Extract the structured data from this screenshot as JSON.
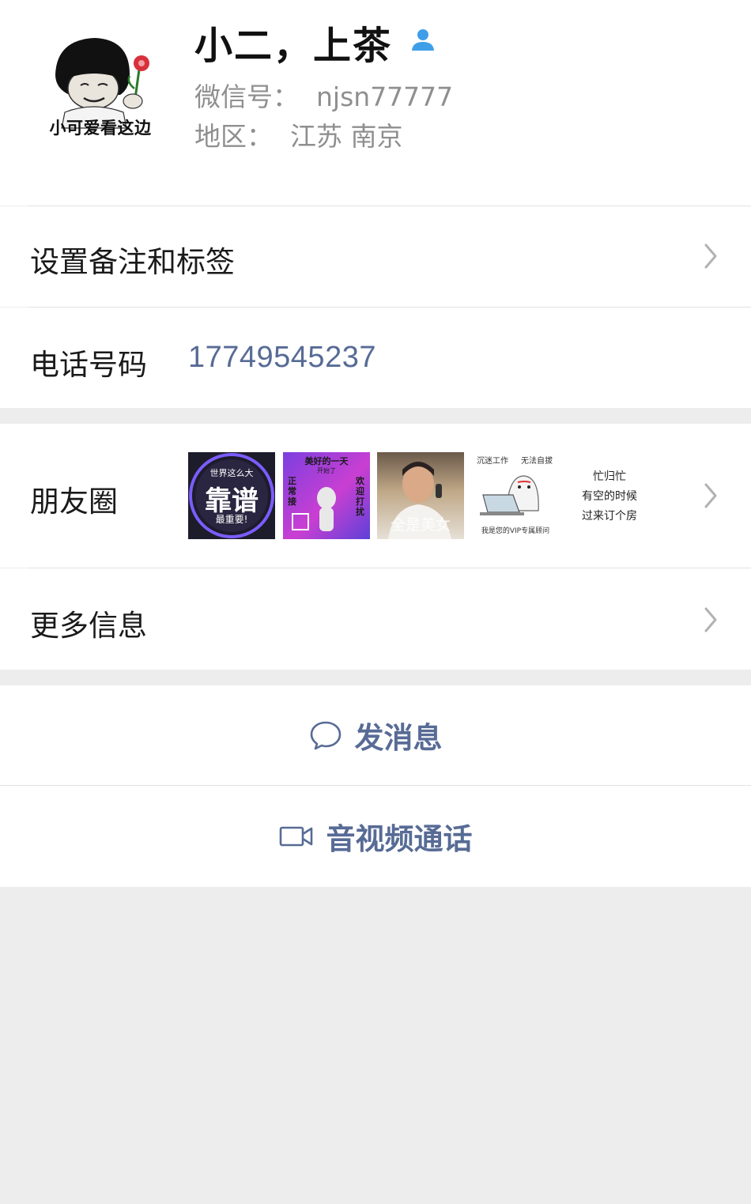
{
  "profile": {
    "name": "小二，上茶",
    "wechat_id_label": "微信号：",
    "wechat_id": "njsn77777",
    "region_label": "地区：",
    "region": "江苏 南京",
    "avatar_caption": "小可爱看这边"
  },
  "rows": {
    "remark_label": "设置备注和标签",
    "phone_label": "电话号码",
    "phone_value": "17749545237",
    "moments_label": "朋友圈",
    "more_label": "更多信息"
  },
  "moments": {
    "thumb1_text_top": "世界这么大",
    "thumb1_text_main": "靠谱",
    "thumb1_text_bottom": "最重要!",
    "thumb2_title": "美好的一天",
    "thumb2_sub": "开始了",
    "thumb2_left": "正常接",
    "thumb2_right": "欢迎打扰",
    "thumb3_caption": "全是美女",
    "thumb4_top_left": "沉迷工作",
    "thumb4_top_right": "无法自拔",
    "thumb4_bottom": "我是您的VIP专属顾问",
    "thumb5_line1": "忙归忙",
    "thumb5_line2": "有空的时候",
    "thumb5_line3": "过来订个房"
  },
  "actions": {
    "message_label": "发消息",
    "call_label": "音视频通话"
  },
  "colors": {
    "accent": "#576b95",
    "person_icon": "#3f9ee8",
    "background": "#ededed"
  }
}
